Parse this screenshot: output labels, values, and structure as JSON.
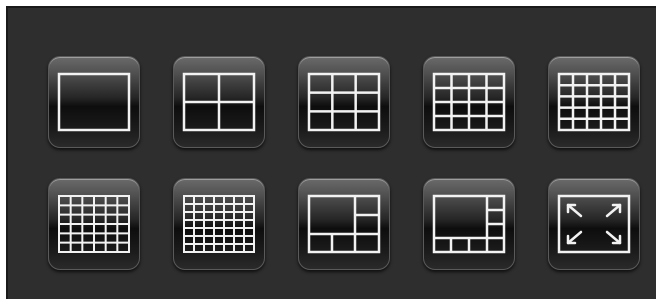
{
  "layout_toolbar": {
    "buttons": [
      {
        "id": "layout-1",
        "icon": "single-view-icon",
        "cols": 1,
        "rows": 1
      },
      {
        "id": "layout-4",
        "icon": "quad-view-icon",
        "cols": 2,
        "rows": 2
      },
      {
        "id": "layout-9",
        "icon": "nine-view-icon",
        "cols": 3,
        "rows": 3
      },
      {
        "id": "layout-16",
        "icon": "sixteen-view-icon",
        "cols": 4,
        "rows": 4
      },
      {
        "id": "layout-25",
        "icon": "twentyfive-view-icon",
        "cols": 5,
        "rows": 5
      },
      {
        "id": "layout-36",
        "icon": "thirtysix-view-icon",
        "cols": 6,
        "rows": 6
      },
      {
        "id": "layout-49",
        "icon": "fortynine-view-icon",
        "cols": 7,
        "rows": 7
      },
      {
        "id": "layout-6",
        "icon": "one-plus-five-view-icon"
      },
      {
        "id": "layout-8",
        "icon": "one-plus-seven-view-icon"
      },
      {
        "id": "fullscreen",
        "icon": "fullscreen-icon"
      }
    ],
    "colors": {
      "panel": "#2e2e2e",
      "icon_stroke": "#f2f2f2"
    }
  }
}
